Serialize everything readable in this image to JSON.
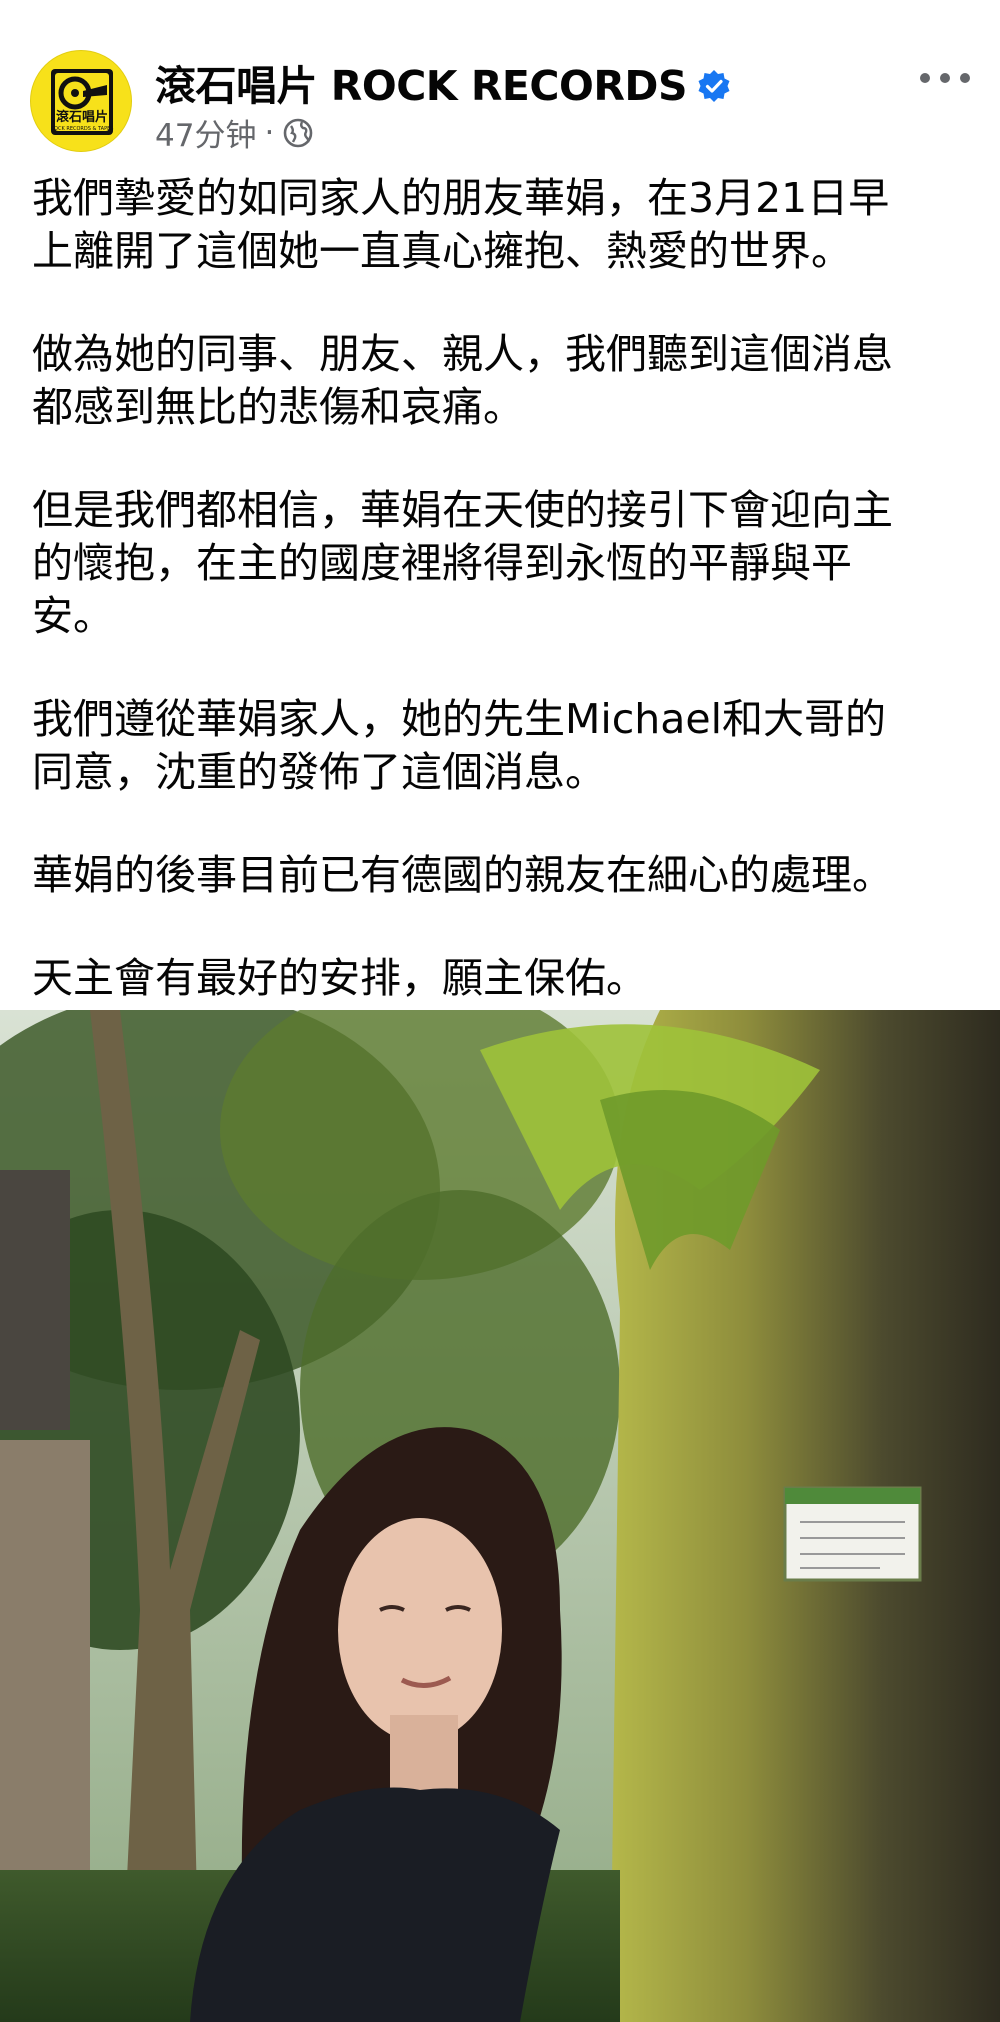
{
  "page": {
    "name": "滾石唱片 ROCK RECORDS",
    "time": "47分钟",
    "separator": "·",
    "avatar_line1": "滾石唱片",
    "avatar_line2": "ROCK RECORDS & TAPES"
  },
  "post": {
    "paragraphs": [
      "我們摯愛的如同家人的朋友華娟，在3月21日早\n上離開了這個她一直真心擁抱、熱愛的世界。",
      "做為她的同事、朋友、親人，我們聽到這個消息\n都感到無比的悲傷和哀痛。",
      "但是我們都相信，華娟在天使的接引下會迎向主\n的懷抱，在主的國度裡將得到永恆的平靜與平\n安。",
      "我們遵從華娟家人，她的先生Michael和大哥的\n同意，沈重的發佈了這個消息。",
      "華娟的後事目前已有德國的親友在細心的處理。",
      "天主會有最好的安排，願主保佑。"
    ]
  },
  "colors": {
    "accent": "#1877f2",
    "meta": "#65676b",
    "avatar_bg": "#f7e11a"
  },
  "icons": {
    "verified": "verified-badge-icon",
    "globe": "globe-icon",
    "more": "more-options-icon"
  }
}
